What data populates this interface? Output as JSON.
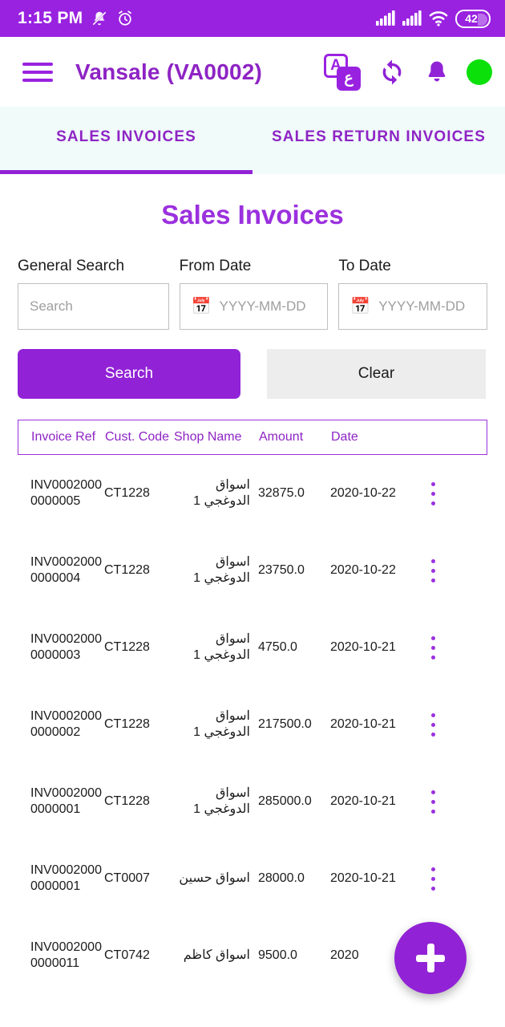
{
  "status_bar": {
    "time": "1:15 PM",
    "icons": [
      "bell-muted-icon",
      "alarm-clock-icon",
      "signal-bars-icon",
      "signal-bars-icon",
      "wifi-icon"
    ],
    "battery_level": "42",
    "background_color": "#9922E0"
  },
  "app_bar": {
    "menu_icon": "hamburger-menu-icon",
    "title": "Vansale (VA0002)",
    "actions": {
      "language_latin": "A",
      "language_arabic": "ع",
      "sync_icon": "sync-refresh-icon",
      "notification_icon": "bell-icon",
      "status_dot": "online-status-dot"
    },
    "title_color": "#8E24C4"
  },
  "tabs": [
    {
      "label": "SALES INVOICES",
      "active": true
    },
    {
      "label": "SALES RETURN INVOICES",
      "active": false
    }
  ],
  "page": {
    "title": "Sales Invoices",
    "accent_color": "#9122D6"
  },
  "filters": {
    "general_search": {
      "label": "General Search",
      "placeholder": "Search",
      "value": ""
    },
    "from_date": {
      "label": "From Date",
      "placeholder": "YYYY-MM-DD",
      "value": "",
      "icon": "calendar-icon"
    },
    "to_date": {
      "label": "To Date",
      "placeholder": "YYYY-MM-DD",
      "value": "",
      "icon": "calendar-icon"
    }
  },
  "buttons": {
    "search_label": "Search",
    "clear_label": "Clear"
  },
  "table": {
    "columns": [
      "Invoice Ref",
      "Cust. Code",
      "Shop Name",
      "Amount",
      "Date"
    ],
    "rows": [
      {
        "invoice_ref": "INV00020000000005",
        "cust_code": "CT1228",
        "shop_name": "اسواق الدوغجي 1",
        "amount": "32875.0",
        "date": "2020-10-22"
      },
      {
        "invoice_ref": "INV00020000000004",
        "cust_code": "CT1228",
        "shop_name": "اسواق الدوغجي 1",
        "amount": "23750.0",
        "date": "2020-10-22"
      },
      {
        "invoice_ref": "INV00020000000003",
        "cust_code": "CT1228",
        "shop_name": "اسواق الدوغجي 1",
        "amount": "4750.0",
        "date": "2020-10-21"
      },
      {
        "invoice_ref": "INV00020000000002",
        "cust_code": "CT1228",
        "shop_name": "اسواق الدوغجي 1",
        "amount": "217500.0",
        "date": "2020-10-21"
      },
      {
        "invoice_ref": "INV00020000000001",
        "cust_code": "CT1228",
        "shop_name": "اسواق الدوغجي 1",
        "amount": "285000.0",
        "date": "2020-10-21"
      },
      {
        "invoice_ref": "INV00020000000001",
        "cust_code": "CT0007",
        "shop_name": "اسواق حسين",
        "amount": "28000.0",
        "date": "2020-10-21"
      },
      {
        "invoice_ref": "INV00020000000011",
        "cust_code": "CT0742",
        "shop_name": "اسواق كاظم",
        "amount": "9500.0",
        "date": "2020"
      }
    ],
    "row_menu_icon": "more-vertical-icon"
  },
  "fab": {
    "icon": "plus-icon",
    "color": "#9122D6"
  }
}
